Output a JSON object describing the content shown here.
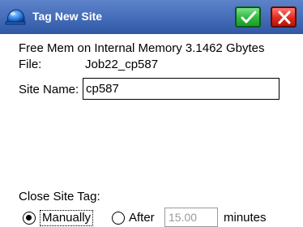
{
  "window": {
    "title": "Tag New Site",
    "app_icon": "helmet-icon",
    "ok_icon": "checkmark-icon",
    "cancel_icon": "close-x-icon",
    "ok_color": "#2fb83d",
    "cancel_color": "#e02a1d",
    "titlebar_color": "#3f67b3"
  },
  "info": {
    "free_mem": "Free Mem on Internal Memory 3.1462 Gbytes",
    "file_label": "File:",
    "file_value": "Job22_cp587"
  },
  "site": {
    "label": "Site Name:",
    "value": "cp587"
  },
  "close_tag": {
    "label": "Close Site Tag:",
    "manual_label": "Manually",
    "manual_selected": true,
    "after_label": "After",
    "after_selected": false,
    "after_value": "15.00",
    "minutes_label": "minutes"
  }
}
